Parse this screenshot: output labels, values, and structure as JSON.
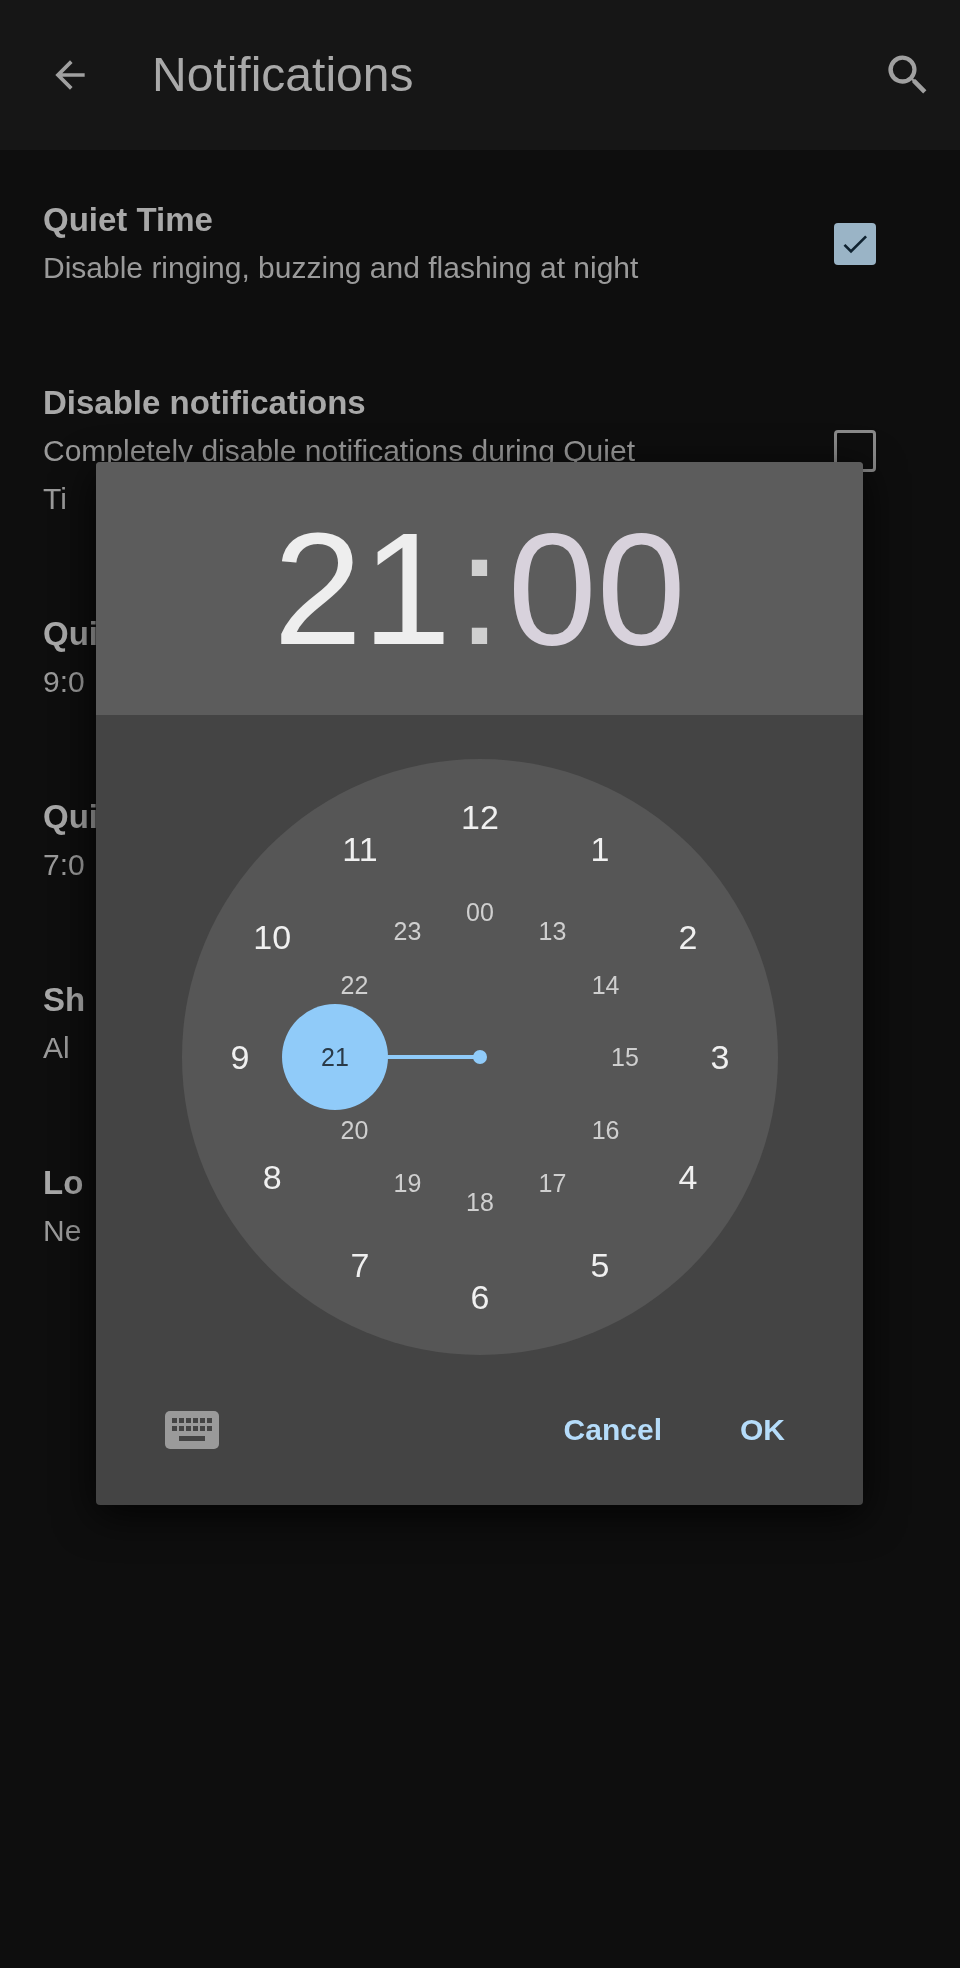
{
  "app_bar": {
    "title": "Notifications"
  },
  "settings": [
    {
      "kind": "checkbox",
      "title": "Quiet Time",
      "subtitle_lines": [
        "Disable ringing, buzzing and flashing at night"
      ],
      "checked": true
    },
    {
      "kind": "checkbox",
      "title": "Disable notifications",
      "subtitle_lines": [
        "Completely disable notifications during Quiet",
        "Ti"
      ],
      "checked": false
    },
    {
      "kind": "text",
      "title": "Qui",
      "subtitle_lines": [
        "9:0"
      ]
    },
    {
      "kind": "text",
      "title": "Qui",
      "subtitle_lines": [
        "7:0"
      ]
    },
    {
      "kind": "text",
      "title": "Sh",
      "subtitle_lines": [
        "Al"
      ]
    },
    {
      "kind": "text",
      "title": "Lo",
      "subtitle_lines": [
        "Ne"
      ]
    }
  ],
  "time_dialog": {
    "hours": "21",
    "separator": ":",
    "minutes": "00",
    "clock": {
      "outer": [
        {
          "label": "12",
          "selected": false
        },
        {
          "label": "1",
          "selected": false
        },
        {
          "label": "2",
          "selected": false
        },
        {
          "label": "3",
          "selected": false
        },
        {
          "label": "4",
          "selected": false
        },
        {
          "label": "5",
          "selected": false
        },
        {
          "label": "6",
          "selected": false
        },
        {
          "label": "7",
          "selected": false
        },
        {
          "label": "8",
          "selected": false
        },
        {
          "label": "9",
          "selected": false
        },
        {
          "label": "10",
          "selected": false
        },
        {
          "label": "11",
          "selected": false
        }
      ],
      "inner": [
        {
          "label": "00",
          "selected": false
        },
        {
          "label": "13",
          "selected": false
        },
        {
          "label": "14",
          "selected": false
        },
        {
          "label": "15",
          "selected": false
        },
        {
          "label": "16",
          "selected": false
        },
        {
          "label": "17",
          "selected": false
        },
        {
          "label": "18",
          "selected": false
        },
        {
          "label": "19",
          "selected": false
        },
        {
          "label": "20",
          "selected": false
        },
        {
          "label": "21",
          "selected": true
        },
        {
          "label": "22",
          "selected": false
        },
        {
          "label": "23",
          "selected": false
        }
      ]
    },
    "buttons": [
      "Cancel",
      "OK"
    ]
  }
}
